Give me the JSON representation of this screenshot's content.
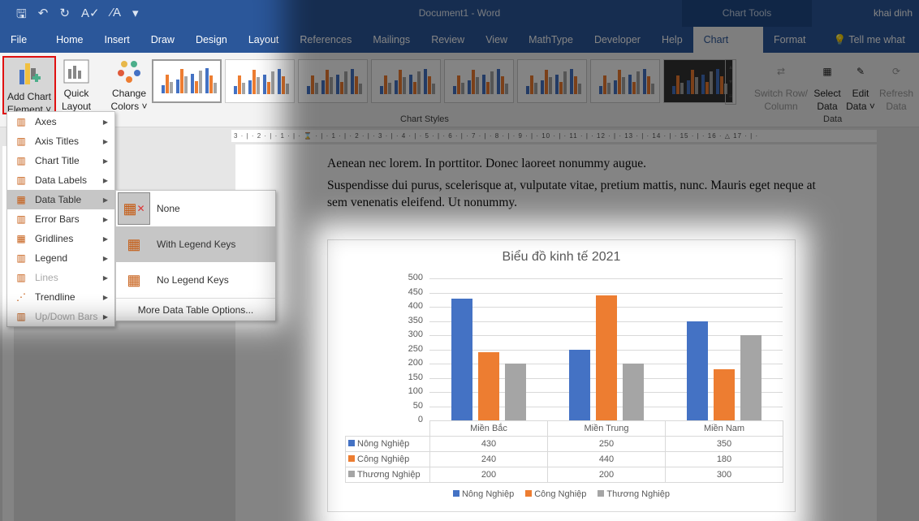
{
  "titlebar": {
    "title": "Document1  -  Word",
    "context": "Chart Tools",
    "user": "khai dinh",
    "qat_icons": [
      "autosave-icon",
      "undo-icon",
      "redo-icon",
      "spelling-icon",
      "font-size-icon",
      "customize-icon"
    ]
  },
  "tabs": [
    "File",
    "Home",
    "Insert",
    "Draw",
    "Design",
    "Layout",
    "References",
    "Mailings",
    "Review",
    "View",
    "MathType",
    "Developer",
    "Help",
    "Chart Design",
    "Format"
  ],
  "active_tab": "Chart Design",
  "tell_me": "Tell me what you",
  "ribbon": {
    "add_chart": "Add Chart Element ˅",
    "quick_layout": "Quick Layout ˅",
    "change_colors": "Change Colors ˅",
    "chart_styles_label": "Chart Styles",
    "switch": "Switch Row/ Column",
    "select_data": "Select Data",
    "edit_data": "Edit Data ˅",
    "refresh_data": "Refresh Data",
    "data_label": "Data"
  },
  "ruler": "3 · | · 2 · | · 1 · | · ⌛ · | · 1 · | · 2 · | · 3 · | · 4 · | · 5 · | · 6 · | · 7 · | · 8 · | · 9 · | · 10 · | · 11 · | · 12 · | · 13 · | · 14 · | · 15 · | · 16 · △ 17 · | ·",
  "document": {
    "para1": "Aenean nec lorem. In porttitor. Donec laoreet nonummy augue.",
    "para2": "Suspendisse dui purus, scelerisque at, vulputate vitae, pretium mattis, nunc. Mauris eget neque at sem venenatis eleifend. Ut nonummy."
  },
  "menu": {
    "items": [
      {
        "label": "Axes",
        "enabled": true
      },
      {
        "label": "Axis Titles",
        "enabled": true
      },
      {
        "label": "Chart Title",
        "enabled": true
      },
      {
        "label": "Data Labels",
        "enabled": true
      },
      {
        "label": "Data Table",
        "enabled": true,
        "highlighted": true
      },
      {
        "label": "Error Bars",
        "enabled": true
      },
      {
        "label": "Gridlines",
        "enabled": true
      },
      {
        "label": "Legend",
        "enabled": true
      },
      {
        "label": "Lines",
        "enabled": false
      },
      {
        "label": "Trendline",
        "enabled": true
      },
      {
        "label": "Up/Down Bars",
        "enabled": false
      }
    ],
    "submenu": [
      {
        "label": "None"
      },
      {
        "label": "With Legend Keys"
      },
      {
        "label": "No Legend Keys"
      }
    ],
    "more": "More Data Table Options..."
  },
  "chart_data": {
    "type": "bar",
    "title": "Biểu đồ kinh tế 2021",
    "categories": [
      "Miền Bắc",
      "Miền Trung",
      "Miền Nam"
    ],
    "series": [
      {
        "name": "Nông Nghiệp",
        "color": "#4472c4",
        "values": [
          430,
          250,
          350
        ]
      },
      {
        "name": "Công Nghiệp",
        "color": "#ed7d31",
        "values": [
          240,
          440,
          180
        ]
      },
      {
        "name": "Thương Nghiệp",
        "color": "#a5a5a5",
        "values": [
          200,
          200,
          300
        ]
      }
    ],
    "ylim": [
      0,
      500
    ],
    "yticks": [
      "0",
      "50",
      "100",
      "150",
      "200",
      "250",
      "300",
      "350",
      "400",
      "450",
      "500"
    ],
    "grid": true,
    "data_table": "with legend keys",
    "legend": "bottom"
  }
}
